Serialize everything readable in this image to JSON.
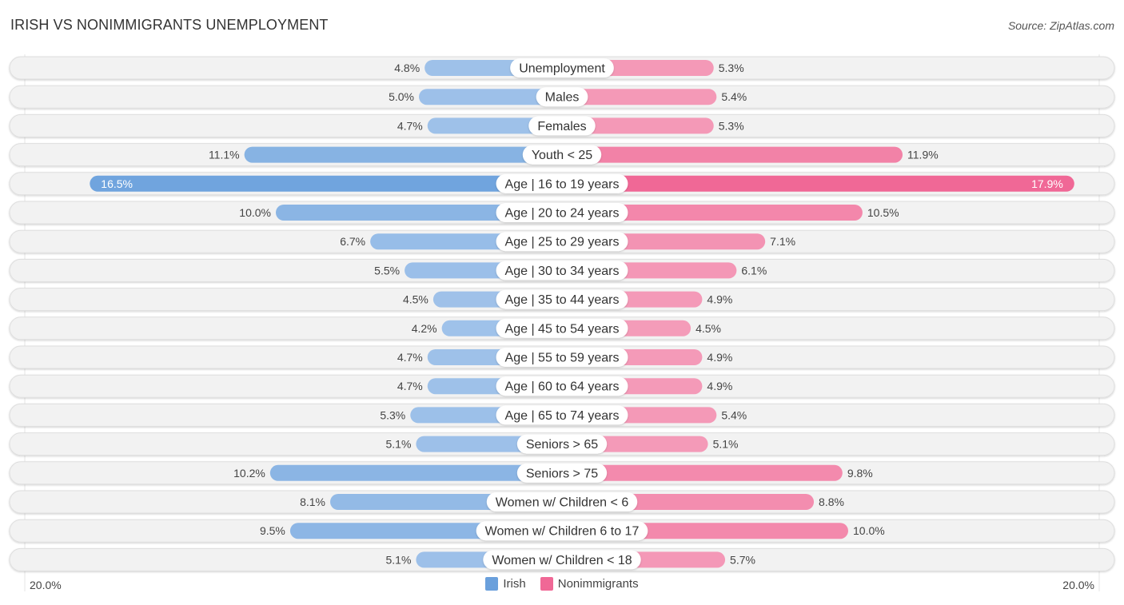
{
  "title": "IRISH VS NONIMMIGRANTS UNEMPLOYMENT",
  "source": "Source: ZipAtlas.com",
  "colors": {
    "irish": "#6aa0dc",
    "irish_light": "#a9c8ec",
    "nonimmigrants": "#f06896",
    "nonimmigrants_light": "#f5a6c0",
    "track": "#f2f2f2"
  },
  "chart_data": {
    "type": "bar",
    "orientation": "horizontal-diverging",
    "title": "IRISH VS NONIMMIGRANTS UNEMPLOYMENT",
    "xlabel": "",
    "ylabel": "",
    "xlim": [
      -20,
      20
    ],
    "axis_labels": {
      "left": "20.0%",
      "right": "20.0%"
    },
    "legend": {
      "position": "bottom-center",
      "entries": [
        "Irish",
        "Nonimmigrants"
      ]
    },
    "categories": [
      "Unemployment",
      "Males",
      "Females",
      "Youth < 25",
      "Age | 16 to 19 years",
      "Age | 20 to 24 years",
      "Age | 25 to 29 years",
      "Age | 30 to 34 years",
      "Age | 35 to 44 years",
      "Age | 45 to 54 years",
      "Age | 55 to 59 years",
      "Age | 60 to 64 years",
      "Age | 65 to 74 years",
      "Seniors > 65",
      "Seniors > 75",
      "Women w/ Children < 6",
      "Women w/ Children 6 to 17",
      "Women w/ Children < 18"
    ],
    "series": [
      {
        "name": "Irish",
        "side": "left",
        "values": [
          4.8,
          5.0,
          4.7,
          11.1,
          16.5,
          10.0,
          6.7,
          5.5,
          4.5,
          4.2,
          4.7,
          4.7,
          5.3,
          5.1,
          10.2,
          8.1,
          9.5,
          5.1
        ],
        "labels": [
          "4.8%",
          "5.0%",
          "4.7%",
          "11.1%",
          "16.5%",
          "10.0%",
          "6.7%",
          "5.5%",
          "4.5%",
          "4.2%",
          "4.7%",
          "4.7%",
          "5.3%",
          "5.1%",
          "10.2%",
          "8.1%",
          "9.5%",
          "5.1%"
        ]
      },
      {
        "name": "Nonimmigrants",
        "side": "right",
        "values": [
          5.3,
          5.4,
          5.3,
          11.9,
          17.9,
          10.5,
          7.1,
          6.1,
          4.9,
          4.5,
          4.9,
          4.9,
          5.4,
          5.1,
          9.8,
          8.8,
          10.0,
          5.7
        ],
        "labels": [
          "5.3%",
          "5.4%",
          "5.3%",
          "11.9%",
          "17.9%",
          "10.5%",
          "7.1%",
          "6.1%",
          "4.9%",
          "4.5%",
          "4.9%",
          "4.9%",
          "5.4%",
          "5.1%",
          "9.8%",
          "8.8%",
          "10.0%",
          "5.7%"
        ]
      }
    ]
  }
}
